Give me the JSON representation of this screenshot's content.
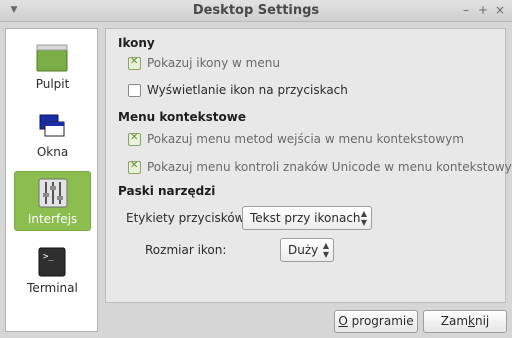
{
  "window": {
    "title": "Desktop Settings"
  },
  "sidebar": {
    "items": [
      {
        "label": "Pulpit",
        "icon": "desktop-icon",
        "active": false
      },
      {
        "label": "Okna",
        "icon": "windows-icon",
        "active": false
      },
      {
        "label": "Interfejs",
        "icon": "sliders-icon",
        "active": true
      },
      {
        "label": "Terminal",
        "icon": "terminal-icon",
        "active": false
      }
    ]
  },
  "sections": {
    "icons": {
      "title": "Ikony",
      "options": [
        {
          "label": "Pokazuj ikony w menu",
          "checked": true
        },
        {
          "label": "Wyświetlanie ikon na przyciskach",
          "checked": false
        }
      ]
    },
    "context_menu": {
      "title": "Menu kontekstowe",
      "options": [
        {
          "label": "Pokazuj menu metod wejścia w menu kontekstowym",
          "checked": true
        },
        {
          "label": "Pokazuj menu kontroli znaków Unicode w menu kontekstowym",
          "checked": true
        }
      ]
    },
    "toolbars": {
      "title": "Paski narzędzi",
      "button_labels": {
        "label": "Etykiety przycisków:",
        "value": "Tekst przy ikonach"
      },
      "icon_size": {
        "label": "Rozmiar ikon:",
        "value": "Duży"
      }
    }
  },
  "buttons": {
    "about": {
      "mnemonic": "O",
      "rest": " programie"
    },
    "close": {
      "prefix": "Zam",
      "mnemonic": "k",
      "rest": "nij"
    }
  },
  "colors": {
    "active_item": "#8cbd4f",
    "check": "#5f8b2f"
  }
}
